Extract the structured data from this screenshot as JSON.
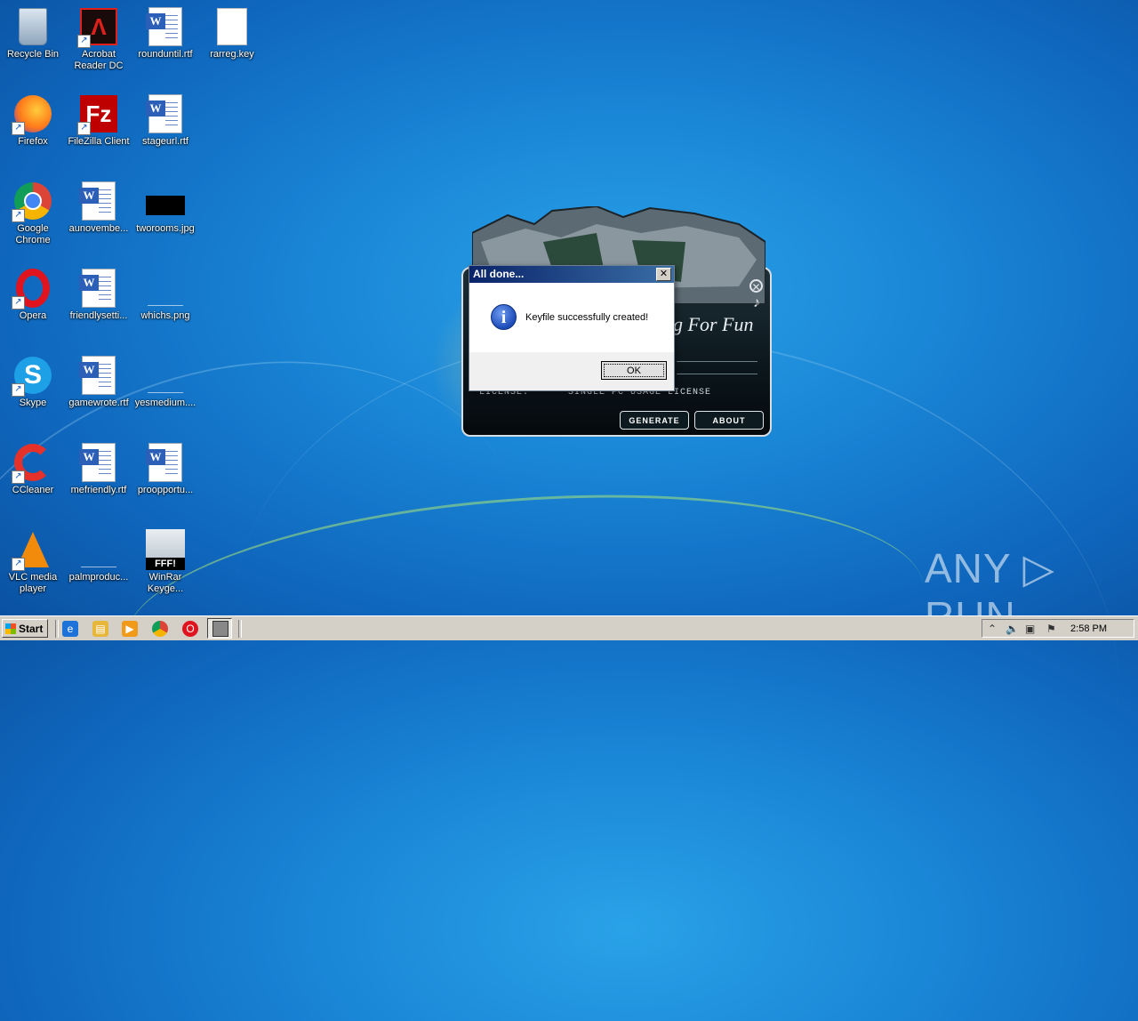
{
  "desktop": {
    "icons": [
      {
        "label": "Recycle Bin",
        "icon": "recycle-bin-icon"
      },
      {
        "label": "Acrobat Reader DC",
        "icon": "acrobat-icon"
      },
      {
        "label": "rounduntil.rtf",
        "icon": "word-doc-icon"
      },
      {
        "label": "rarreg.key",
        "icon": "blank-file-icon"
      },
      {
        "label": "Firefox",
        "icon": "firefox-icon"
      },
      {
        "label": "FileZilla Client",
        "icon": "filezilla-icon"
      },
      {
        "label": "stageurl.rtf",
        "icon": "word-doc-icon"
      },
      {
        "label": "Google Chrome",
        "icon": "chrome-icon"
      },
      {
        "label": "aunovembe...",
        "icon": "word-doc-icon"
      },
      {
        "label": "tworooms.jpg",
        "icon": "image-file-icon"
      },
      {
        "label": "Opera",
        "icon": "opera-icon"
      },
      {
        "label": "friendlysetti...",
        "icon": "word-doc-icon"
      },
      {
        "label": "whichs.png",
        "icon": "image-file-icon"
      },
      {
        "label": "Skype",
        "icon": "skype-icon"
      },
      {
        "label": "gamewrote.rtf",
        "icon": "word-doc-icon"
      },
      {
        "label": "yesmedium....",
        "icon": "image-file-icon"
      },
      {
        "label": "CCleaner",
        "icon": "ccleaner-icon"
      },
      {
        "label": "mefriendly.rtf",
        "icon": "word-doc-icon"
      },
      {
        "label": "proopportu...",
        "icon": "word-doc-icon"
      },
      {
        "label": "VLC media player",
        "icon": "vlc-icon"
      },
      {
        "label": "palmproduc...",
        "icon": "image-file-icon"
      },
      {
        "label": "WinRar Keyge...",
        "icon": "winrar-keygen-icon"
      }
    ]
  },
  "keygen": {
    "title": "g For Fun",
    "license_label": "LICENSE:",
    "license_value": "SINGLE PC USAGE LICENSE",
    "generate_label": "GENERATE",
    "about_label": "ABOUT",
    "winrar_badge": "FFF!"
  },
  "dialog": {
    "title": "All done...",
    "close_glyph": "✕",
    "message": "Keyfile successfully created!",
    "ok_label": "OK",
    "info_glyph": "i"
  },
  "taskbar": {
    "start_label": "Start",
    "clock": "2:58 PM"
  },
  "watermark": "ANY ▷ RUN"
}
